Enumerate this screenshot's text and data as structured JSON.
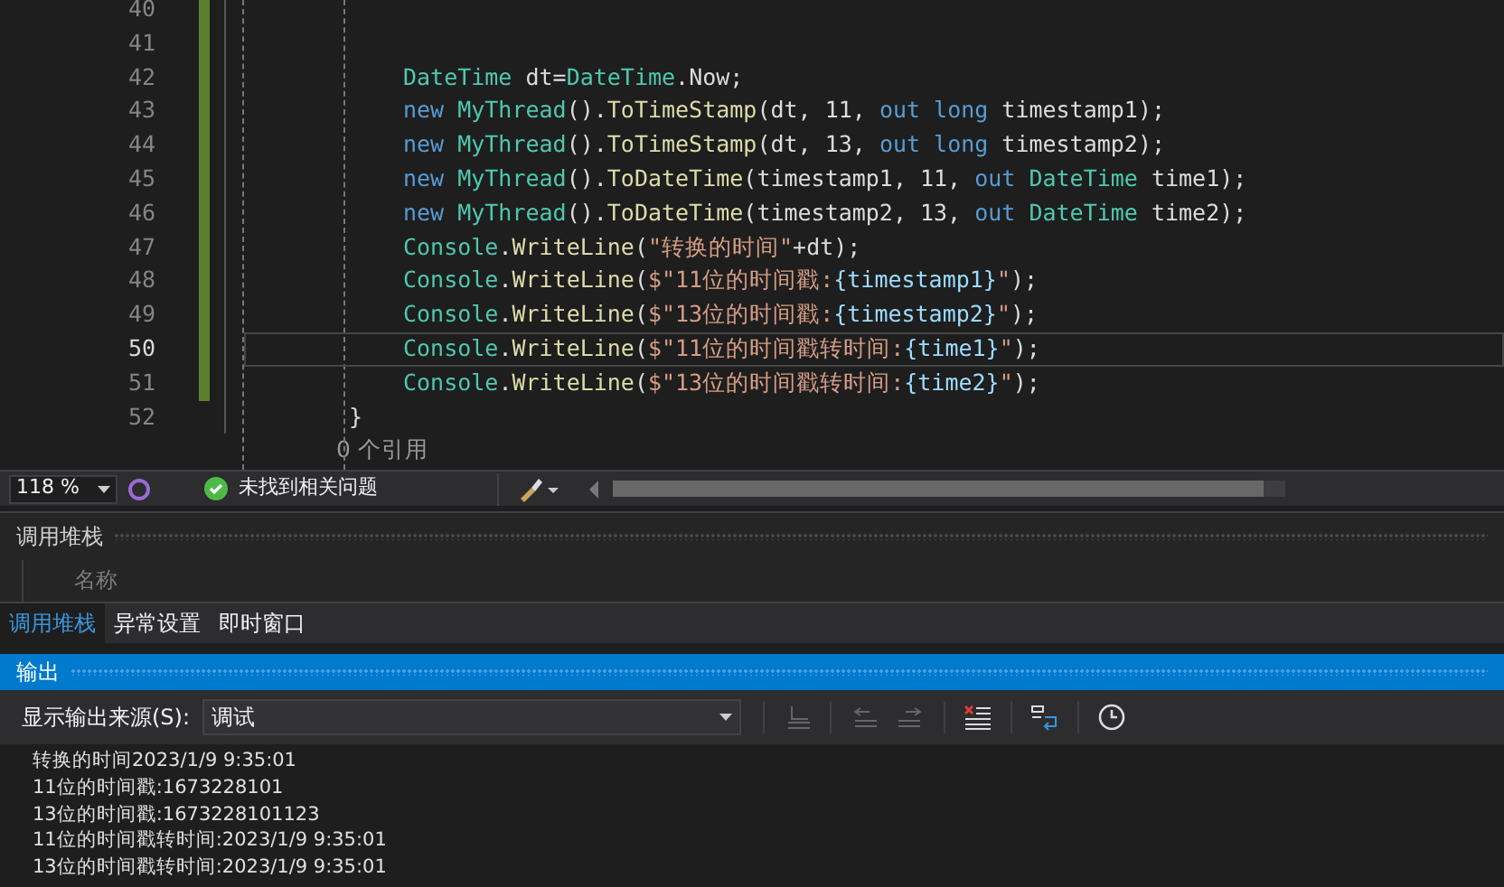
{
  "editor": {
    "lines": [
      {
        "number": "40",
        "kind": "blank",
        "changed": true,
        "current": false
      },
      {
        "number": "41",
        "kind": "blank",
        "changed": true,
        "current": false
      },
      {
        "number": "42",
        "kind": "statement",
        "changed": true,
        "current": false,
        "tokens": [
          {
            "text": "DateTime",
            "kind": "type"
          },
          {
            "text": " dt=",
            "kind": "plain"
          },
          {
            "text": "DateTime",
            "kind": "type"
          },
          {
            "text": ".Now;",
            "kind": "plain"
          }
        ]
      },
      {
        "number": "43",
        "kind": "statement",
        "changed": true,
        "current": false,
        "tokens": [
          {
            "text": "new ",
            "kind": "keyword"
          },
          {
            "text": "MyThread",
            "kind": "type"
          },
          {
            "text": "().",
            "kind": "plain"
          },
          {
            "text": "ToTimeStamp",
            "kind": "method"
          },
          {
            "text": "(dt, 11, ",
            "kind": "plain"
          },
          {
            "text": "out long",
            "kind": "keyword"
          },
          {
            "text": " timestamp1);",
            "kind": "plain"
          }
        ]
      },
      {
        "number": "44",
        "kind": "statement",
        "changed": true,
        "current": false,
        "tokens": [
          {
            "text": "new ",
            "kind": "keyword"
          },
          {
            "text": "MyThread",
            "kind": "type"
          },
          {
            "text": "().",
            "kind": "plain"
          },
          {
            "text": "ToTimeStamp",
            "kind": "method"
          },
          {
            "text": "(dt, 13, ",
            "kind": "plain"
          },
          {
            "text": "out long",
            "kind": "keyword"
          },
          {
            "text": " timestamp2);",
            "kind": "plain"
          }
        ]
      },
      {
        "number": "45",
        "kind": "statement",
        "changed": true,
        "current": false,
        "tokens": [
          {
            "text": "new ",
            "kind": "keyword"
          },
          {
            "text": "MyThread",
            "kind": "type"
          },
          {
            "text": "().",
            "kind": "plain"
          },
          {
            "text": "ToDateTime",
            "kind": "method"
          },
          {
            "text": "(timestamp1, 11, ",
            "kind": "plain"
          },
          {
            "text": "out ",
            "kind": "keyword"
          },
          {
            "text": "DateTime",
            "kind": "type"
          },
          {
            "text": " time1);",
            "kind": "plain"
          }
        ]
      },
      {
        "number": "46",
        "kind": "statement",
        "changed": true,
        "current": false,
        "tokens": [
          {
            "text": "new ",
            "kind": "keyword"
          },
          {
            "text": "MyThread",
            "kind": "type"
          },
          {
            "text": "().",
            "kind": "plain"
          },
          {
            "text": "ToDateTime",
            "kind": "method"
          },
          {
            "text": "(timestamp2, 13, ",
            "kind": "plain"
          },
          {
            "text": "out ",
            "kind": "keyword"
          },
          {
            "text": "DateTime",
            "kind": "type"
          },
          {
            "text": " time2);",
            "kind": "plain"
          }
        ]
      },
      {
        "number": "47",
        "kind": "statement",
        "changed": true,
        "current": false,
        "tokens": [
          {
            "text": "Console",
            "kind": "type"
          },
          {
            "text": ".",
            "kind": "plain"
          },
          {
            "text": "WriteLine",
            "kind": "method"
          },
          {
            "text": "(",
            "kind": "plain"
          },
          {
            "text": "\"转换的时间\"",
            "kind": "string"
          },
          {
            "text": "+dt);",
            "kind": "plain"
          }
        ]
      },
      {
        "number": "48",
        "kind": "statement",
        "changed": true,
        "current": false,
        "tokens": [
          {
            "text": "Console",
            "kind": "type"
          },
          {
            "text": ".",
            "kind": "plain"
          },
          {
            "text": "WriteLine",
            "kind": "method"
          },
          {
            "text": "(",
            "kind": "plain"
          },
          {
            "text": "$\"11位的时间戳:",
            "kind": "string"
          },
          {
            "text": "{timestamp1}",
            "kind": "interp"
          },
          {
            "text": "\"",
            "kind": "string"
          },
          {
            "text": ");",
            "kind": "plain"
          }
        ]
      },
      {
        "number": "49",
        "kind": "statement",
        "changed": true,
        "current": false,
        "tokens": [
          {
            "text": "Console",
            "kind": "type"
          },
          {
            "text": ".",
            "kind": "plain"
          },
          {
            "text": "WriteLine",
            "kind": "method"
          },
          {
            "text": "(",
            "kind": "plain"
          },
          {
            "text": "$\"13位的时间戳:",
            "kind": "string"
          },
          {
            "text": "{timestamp2}",
            "kind": "interp"
          },
          {
            "text": "\"",
            "kind": "string"
          },
          {
            "text": ");",
            "kind": "plain"
          }
        ]
      },
      {
        "number": "50",
        "kind": "statement",
        "changed": true,
        "current": true,
        "tokens": [
          {
            "text": "Console",
            "kind": "type"
          },
          {
            "text": ".",
            "kind": "plain"
          },
          {
            "text": "WriteLine",
            "kind": "method"
          },
          {
            "text": "(",
            "kind": "plain"
          },
          {
            "text": "$\"11位的时间戳转时间:",
            "kind": "string"
          },
          {
            "text": "{time1}",
            "kind": "interp"
          },
          {
            "text": "\"",
            "kind": "string"
          },
          {
            "text": ");",
            "kind": "plain"
          }
        ]
      },
      {
        "number": "51",
        "kind": "statement",
        "changed": true,
        "current": false,
        "tokens": [
          {
            "text": "Console",
            "kind": "type"
          },
          {
            "text": ".",
            "kind": "plain"
          },
          {
            "text": "WriteLine",
            "kind": "method"
          },
          {
            "text": "(",
            "kind": "plain"
          },
          {
            "text": "$\"13位的时间戳转时间:",
            "kind": "string"
          },
          {
            "text": "{time2}",
            "kind": "interp"
          },
          {
            "text": "\"",
            "kind": "string"
          },
          {
            "text": ");",
            "kind": "plain"
          }
        ]
      },
      {
        "number": "52",
        "kind": "brace",
        "changed": false,
        "current": false,
        "tokens": [
          {
            "text": "}",
            "kind": "plain"
          }
        ]
      }
    ],
    "codelens": "0 个引用"
  },
  "status_bar": {
    "zoom": "118 %",
    "issues": "未找到相关问题"
  },
  "call_stack": {
    "title": "调用堆栈",
    "column": "名称"
  },
  "tabs": [
    {
      "label": "调用堆栈",
      "selected": true
    },
    {
      "label": "异常设置",
      "selected": false
    },
    {
      "label": "即时窗口",
      "selected": false
    }
  ],
  "output": {
    "title": "输出",
    "source_label": "显示输出来源(S):",
    "source": "调试",
    "lines": [
      "转换的时间2023/1/9 9:35:01",
      "11位的时间戳:1673228101",
      "13位的时间戳:1673228101123",
      "11位的时间戳转时间:2023/1/9 9:35:01",
      "13位的时间戳转时间:2023/1/9 9:35:01"
    ]
  }
}
